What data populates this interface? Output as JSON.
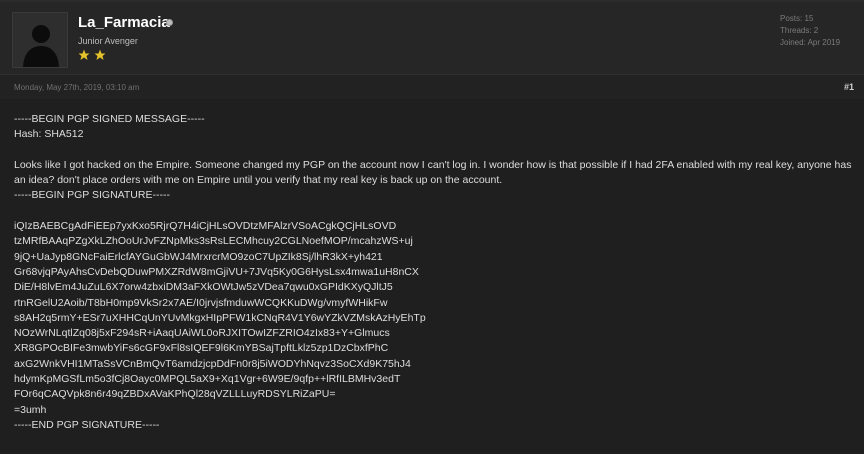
{
  "user": {
    "name": "La_Farmacia",
    "rank": "Junior Avenger",
    "star_count": 2,
    "star_color": "#e3c329",
    "stats": [
      "Posts: 15",
      "Threads: 2",
      "Joined: Apr 2019"
    ]
  },
  "post": {
    "date": "Monday, May 27th, 2019, 03:10 am",
    "number": "#1",
    "lines": [
      "-----BEGIN PGP SIGNED MESSAGE-----",
      "Hash: SHA512",
      "",
      "Looks like I got hacked on the Empire. Someone changed my PGP on the account now I can't log in. I wonder how is that possible if I had 2FA enabled with my real key, anyone has an idea? don't place orders with me on Empire until you verify that my real key is back up on the account.",
      "-----BEGIN PGP SIGNATURE-----",
      "",
      "iQIzBAEBCgAdFiEEp7yxKxo5RjrQ7H4iCjHLsOVDtzMFAlzrVSoACgkQCjHLsOVD",
      "tzMRfBAAqPZgXkLZhOoUrJvFZNpMks3sRsLECMhcuy2CGLNoefMOP/mcahzWS+uj",
      "9jQ+UaJyp8GNcFaiErlcfAYGuGbWJ4MrxrcrMO9zoC7UpZIk8Sj/lhR3kX+yh421",
      "Gr68vjqPAyAhsCvDebQDuwPMXZRdW8mGjiVU+7JVq5Ky0G6HysLsx4mwa1uH8nCX",
      "DiE/H8lvEm4JuZuL6X7orw4zbxiDM3aFXkOWtJw5zVDea7qwu0xGPIdKXyQJltJ5",
      "rtnRGelU2Aoib/T8bH0mp9VkSr2x7AE/I0jrvjsfmduwWCQKKuDWg/vmyfWHikFw",
      "s8AH2q5rmY+ESr7uXHHCqUnYUvMkgxHIpPFW1kCNqR4V1Y6wYZkVZMskAzHyEhTp",
      "NOzWrNLqtlZq08j5xF294sR+iAaqUAiWL0oRJXITOwIZFZRIO4zIx83+Y+Glmucs",
      "XR8GPOcBIFe3mwbYiFs6cGF9xFl8sIQEF9l6KmYBSajTpftLklz5zp1DzCbxfPhC",
      "axG2WnkVHI1MTaSsVCnBmQvT6amdzjcpDdFn0r8j5iWODYhNqvz3SoCXd9K75hJ4",
      "hdymKpMGSfLm5o3fCj8Oayc0MPQL5aX9+Xq1Vgr+6W9E/9qfp++lRfILBMHv3edT",
      "FOr6qCAQVpk8n6r49qZBDxAVaKPhQl28qVZLLLuyRDSYLRiZaPU=",
      "=3umh",
      "-----END PGP SIGNATURE-----"
    ]
  }
}
